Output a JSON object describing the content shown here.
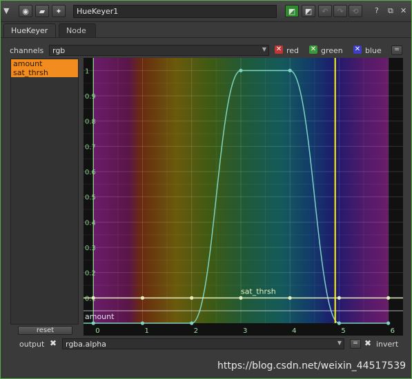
{
  "window": {
    "node_name": "HueKeyer1"
  },
  "tabs": [
    {
      "label": "HueKeyer",
      "active": true
    },
    {
      "label": "Node",
      "active": false
    }
  ],
  "channels": {
    "label": "channels",
    "value": "rgb",
    "checks": [
      {
        "label": "red",
        "color": "#c83a3a",
        "checked": true
      },
      {
        "label": "green",
        "color": "#3a9a3a",
        "checked": true
      },
      {
        "label": "blue",
        "color": "#3a3ac8",
        "checked": true
      }
    ],
    "link_button": "="
  },
  "curves": {
    "items": [
      "amount",
      "sat_thrsh"
    ],
    "reset_label": "reset"
  },
  "graph": {
    "y_ticks": [
      "1",
      "0.9",
      "0.8",
      "0.7",
      "0.6",
      "0.5",
      "0.4",
      "0.3",
      "0.2",
      "0.1"
    ],
    "x_ticks": [
      "0",
      "1",
      "2",
      "3",
      "4",
      "5",
      "6"
    ],
    "curve_labels": {
      "amount": "amount",
      "sat_thrsh": "sat_thrsh"
    },
    "curve_color": "#7fd3c2",
    "sat_color": "#e8f0c0",
    "cursor_color": "#ffff00",
    "marker_x": 4.92
  },
  "chart_data": {
    "type": "line",
    "xlim": [
      -0.2,
      6.3
    ],
    "ylim": [
      0,
      1.05
    ],
    "series": [
      {
        "name": "amount",
        "x": [
          0,
          1,
          2,
          3,
          4,
          5,
          6
        ],
        "y": [
          0,
          0,
          0,
          1,
          1,
          0,
          0
        ]
      },
      {
        "name": "sat_thrsh",
        "x": [
          0,
          1,
          2,
          3,
          4,
          5,
          6
        ],
        "y": [
          0.1,
          0.1,
          0.1,
          0.1,
          0.1,
          0.1,
          0.1
        ]
      }
    ]
  },
  "output": {
    "label": "output",
    "value": "rgba.alpha",
    "invert_label": "invert",
    "link_button": "="
  },
  "watermark": "https://blog.csdn.net/weixin_44517539"
}
